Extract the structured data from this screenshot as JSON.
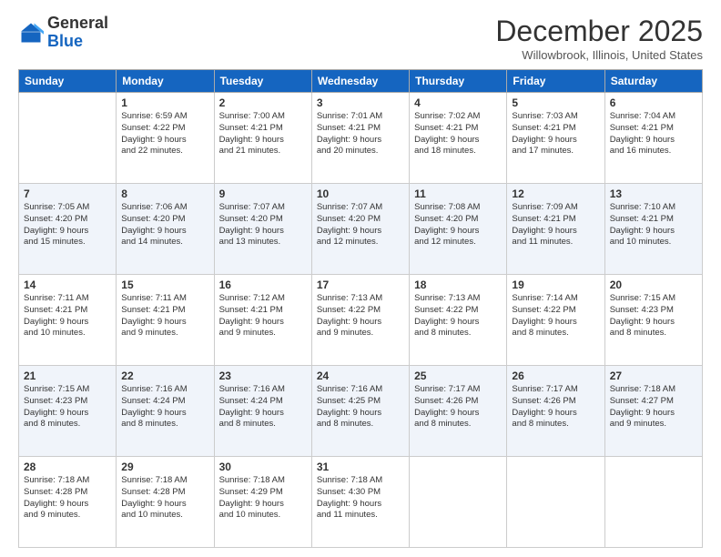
{
  "logo": {
    "general": "General",
    "blue": "Blue"
  },
  "header": {
    "month": "December 2025",
    "location": "Willowbrook, Illinois, United States"
  },
  "weekdays": [
    "Sunday",
    "Monday",
    "Tuesday",
    "Wednesday",
    "Thursday",
    "Friday",
    "Saturday"
  ],
  "weeks": [
    [
      {
        "day": "",
        "info": ""
      },
      {
        "day": "1",
        "info": "Sunrise: 6:59 AM\nSunset: 4:22 PM\nDaylight: 9 hours\nand 22 minutes."
      },
      {
        "day": "2",
        "info": "Sunrise: 7:00 AM\nSunset: 4:21 PM\nDaylight: 9 hours\nand 21 minutes."
      },
      {
        "day": "3",
        "info": "Sunrise: 7:01 AM\nSunset: 4:21 PM\nDaylight: 9 hours\nand 20 minutes."
      },
      {
        "day": "4",
        "info": "Sunrise: 7:02 AM\nSunset: 4:21 PM\nDaylight: 9 hours\nand 18 minutes."
      },
      {
        "day": "5",
        "info": "Sunrise: 7:03 AM\nSunset: 4:21 PM\nDaylight: 9 hours\nand 17 minutes."
      },
      {
        "day": "6",
        "info": "Sunrise: 7:04 AM\nSunset: 4:21 PM\nDaylight: 9 hours\nand 16 minutes."
      }
    ],
    [
      {
        "day": "7",
        "info": "Sunrise: 7:05 AM\nSunset: 4:20 PM\nDaylight: 9 hours\nand 15 minutes."
      },
      {
        "day": "8",
        "info": "Sunrise: 7:06 AM\nSunset: 4:20 PM\nDaylight: 9 hours\nand 14 minutes."
      },
      {
        "day": "9",
        "info": "Sunrise: 7:07 AM\nSunset: 4:20 PM\nDaylight: 9 hours\nand 13 minutes."
      },
      {
        "day": "10",
        "info": "Sunrise: 7:07 AM\nSunset: 4:20 PM\nDaylight: 9 hours\nand 12 minutes."
      },
      {
        "day": "11",
        "info": "Sunrise: 7:08 AM\nSunset: 4:20 PM\nDaylight: 9 hours\nand 12 minutes."
      },
      {
        "day": "12",
        "info": "Sunrise: 7:09 AM\nSunset: 4:21 PM\nDaylight: 9 hours\nand 11 minutes."
      },
      {
        "day": "13",
        "info": "Sunrise: 7:10 AM\nSunset: 4:21 PM\nDaylight: 9 hours\nand 10 minutes."
      }
    ],
    [
      {
        "day": "14",
        "info": "Sunrise: 7:11 AM\nSunset: 4:21 PM\nDaylight: 9 hours\nand 10 minutes."
      },
      {
        "day": "15",
        "info": "Sunrise: 7:11 AM\nSunset: 4:21 PM\nDaylight: 9 hours\nand 9 minutes."
      },
      {
        "day": "16",
        "info": "Sunrise: 7:12 AM\nSunset: 4:21 PM\nDaylight: 9 hours\nand 9 minutes."
      },
      {
        "day": "17",
        "info": "Sunrise: 7:13 AM\nSunset: 4:22 PM\nDaylight: 9 hours\nand 9 minutes."
      },
      {
        "day": "18",
        "info": "Sunrise: 7:13 AM\nSunset: 4:22 PM\nDaylight: 9 hours\nand 8 minutes."
      },
      {
        "day": "19",
        "info": "Sunrise: 7:14 AM\nSunset: 4:22 PM\nDaylight: 9 hours\nand 8 minutes."
      },
      {
        "day": "20",
        "info": "Sunrise: 7:15 AM\nSunset: 4:23 PM\nDaylight: 9 hours\nand 8 minutes."
      }
    ],
    [
      {
        "day": "21",
        "info": "Sunrise: 7:15 AM\nSunset: 4:23 PM\nDaylight: 9 hours\nand 8 minutes."
      },
      {
        "day": "22",
        "info": "Sunrise: 7:16 AM\nSunset: 4:24 PM\nDaylight: 9 hours\nand 8 minutes."
      },
      {
        "day": "23",
        "info": "Sunrise: 7:16 AM\nSunset: 4:24 PM\nDaylight: 9 hours\nand 8 minutes."
      },
      {
        "day": "24",
        "info": "Sunrise: 7:16 AM\nSunset: 4:25 PM\nDaylight: 9 hours\nand 8 minutes."
      },
      {
        "day": "25",
        "info": "Sunrise: 7:17 AM\nSunset: 4:26 PM\nDaylight: 9 hours\nand 8 minutes."
      },
      {
        "day": "26",
        "info": "Sunrise: 7:17 AM\nSunset: 4:26 PM\nDaylight: 9 hours\nand 8 minutes."
      },
      {
        "day": "27",
        "info": "Sunrise: 7:18 AM\nSunset: 4:27 PM\nDaylight: 9 hours\nand 9 minutes."
      }
    ],
    [
      {
        "day": "28",
        "info": "Sunrise: 7:18 AM\nSunset: 4:28 PM\nDaylight: 9 hours\nand 9 minutes."
      },
      {
        "day": "29",
        "info": "Sunrise: 7:18 AM\nSunset: 4:28 PM\nDaylight: 9 hours\nand 10 minutes."
      },
      {
        "day": "30",
        "info": "Sunrise: 7:18 AM\nSunset: 4:29 PM\nDaylight: 9 hours\nand 10 minutes."
      },
      {
        "day": "31",
        "info": "Sunrise: 7:18 AM\nSunset: 4:30 PM\nDaylight: 9 hours\nand 11 minutes."
      },
      {
        "day": "",
        "info": ""
      },
      {
        "day": "",
        "info": ""
      },
      {
        "day": "",
        "info": ""
      }
    ]
  ]
}
